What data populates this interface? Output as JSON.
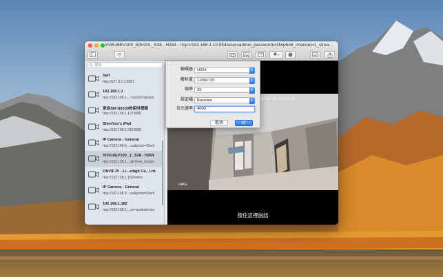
{
  "window": {
    "title": "Hi3516EV100_50H20L_S38 - H264 - rtsp://192.168.1.10:554/user=admin_password=tlJwpbo6_channel=1_stream=0.sdp?real..."
  },
  "sidebar": {
    "search_placeholder": "搜尋",
    "devices": [
      {
        "name": "Self",
        "url": "http://127.0.0.1:8081"
      },
      {
        "name": "192.168.1.1",
        "url": "rtsp://192.168.1....?action=stream"
      },
      {
        "name": "来自SM-N9100的实时视频",
        "url": "http://192.168.1.107:8081"
      },
      {
        "name": "ShenYao's iPad",
        "url": "http://192.168.1.218:8081"
      },
      {
        "name": "IP Camera - General",
        "url": "rtsp://192.168.0....ue&proto=Onvif"
      },
      {
        "name": "Hi3516EV100...L_S38 - H264",
        "url": "rtsp://192.168.1....dp?real_stream"
      },
      {
        "name": "ONVIF-Pi - Li...edigit Co., Ltd.",
        "url": "rtsp://192.168.1.150/video"
      },
      {
        "name": "IP Camera - General",
        "url": "rtsp://192.168.0....ue&proto=Onvif"
      },
      {
        "name": "192.168.1.182",
        "url": "rtsp://192.168.1....ce+audiodevice"
      }
    ],
    "selected_index": 5,
    "bottom_buttons": {
      "add": "+",
      "remove": "−",
      "settings": "✱",
      "play": "▶"
    }
  },
  "settings": {
    "encoder_label": "編碼器",
    "encoder_value": "H264",
    "resolution_label": "解析度",
    "resolution_value": "1280x720",
    "fps_label": "幀率",
    "fps_value": "25",
    "profile_label": "設定檔",
    "profile_value": "Baseline",
    "bitrate_label": "位元速率",
    "bitrate_value": "4000",
    "cancel_label": "取消",
    "ok_label": "好"
  },
  "video": {
    "timestamp": "2018-11-06 17:17:15",
    "camera_label": "CAM01",
    "talk_label": "按住這裡說話"
  },
  "colors": {
    "accent": "#2a78ec",
    "sidebar_bg": "#dfe5ee",
    "close": "#fc605c",
    "minimize": "#fdbc40",
    "zoom": "#34c84a"
  }
}
